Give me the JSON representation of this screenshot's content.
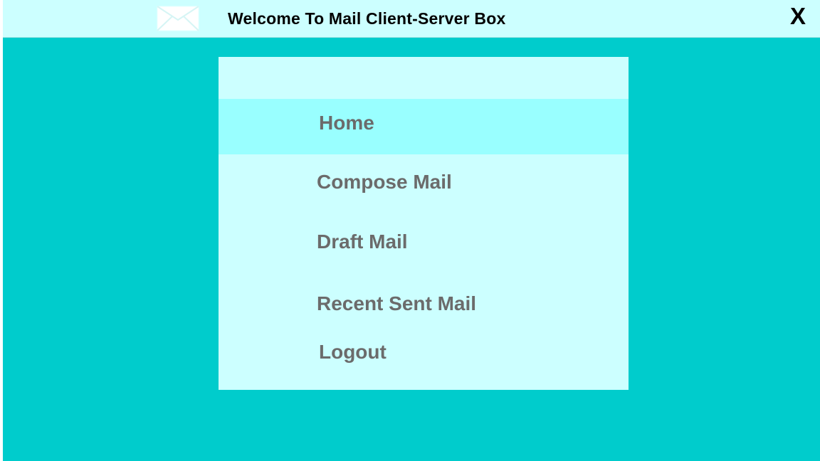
{
  "window": {
    "title": "Welcome To Mail Client-Server Box",
    "close_label": "X",
    "icon": "envelope-icon",
    "colors": {
      "background": "#00cccc",
      "title_bar": "#ccffff",
      "menu_panel": "#ccffff",
      "active_item": "#99ffff",
      "menu_text": "#6b6b6b"
    }
  },
  "menu": {
    "items": [
      {
        "label": "Home",
        "active": true
      },
      {
        "label": "Compose Mail",
        "active": false
      },
      {
        "label": "Draft Mail",
        "active": false
      },
      {
        "label": "Recent Sent Mail",
        "active": false
      },
      {
        "label": "Logout",
        "active": false
      }
    ]
  }
}
